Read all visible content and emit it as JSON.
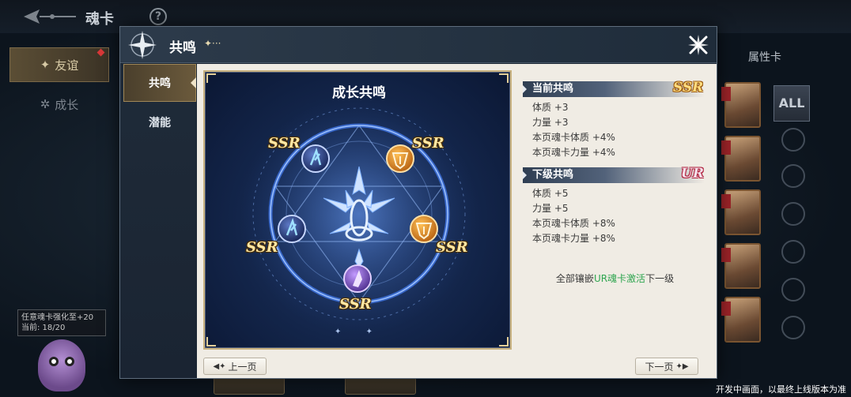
{
  "background": {
    "title": "魂卡",
    "help_label": "?",
    "tabs": {
      "friend": "友谊",
      "grow": "成长"
    },
    "attr_label": "属性卡",
    "all_label": "ALL",
    "tip": {
      "line1": "任意魂卡强化至+20",
      "line2": "当前: 18/20"
    },
    "footnote": "开发中画面，以最终上线版本为准"
  },
  "dialog": {
    "title": "共鸣",
    "title_deco": "✦···",
    "side_tabs": [
      {
        "label": "共鸣"
      },
      {
        "label": "潜能"
      }
    ],
    "resonance": {
      "title": "成长共鸣",
      "slots": [
        "SSR",
        "SSR",
        "SSR",
        "SSR",
        "SSR"
      ],
      "dots": "✦ ✦"
    },
    "current": {
      "heading": "当前共鸣",
      "rank": "SSR",
      "stats": [
        "体质 +3",
        "力量 +3",
        "本页魂卡体质 +4%",
        "本页魂卡力量 +4%"
      ]
    },
    "next": {
      "heading": "下级共鸣",
      "rank": "UR",
      "stats": [
        "体质 +5",
        "力量 +5",
        "本页魂卡体质 +8%",
        "本页魂卡力量 +8%"
      ]
    },
    "activate": {
      "pre": "全部镶嵌",
      "highlight": "UR魂卡激活",
      "post": "下一级"
    },
    "prev_label": "上一页",
    "next_label": "下一页"
  }
}
